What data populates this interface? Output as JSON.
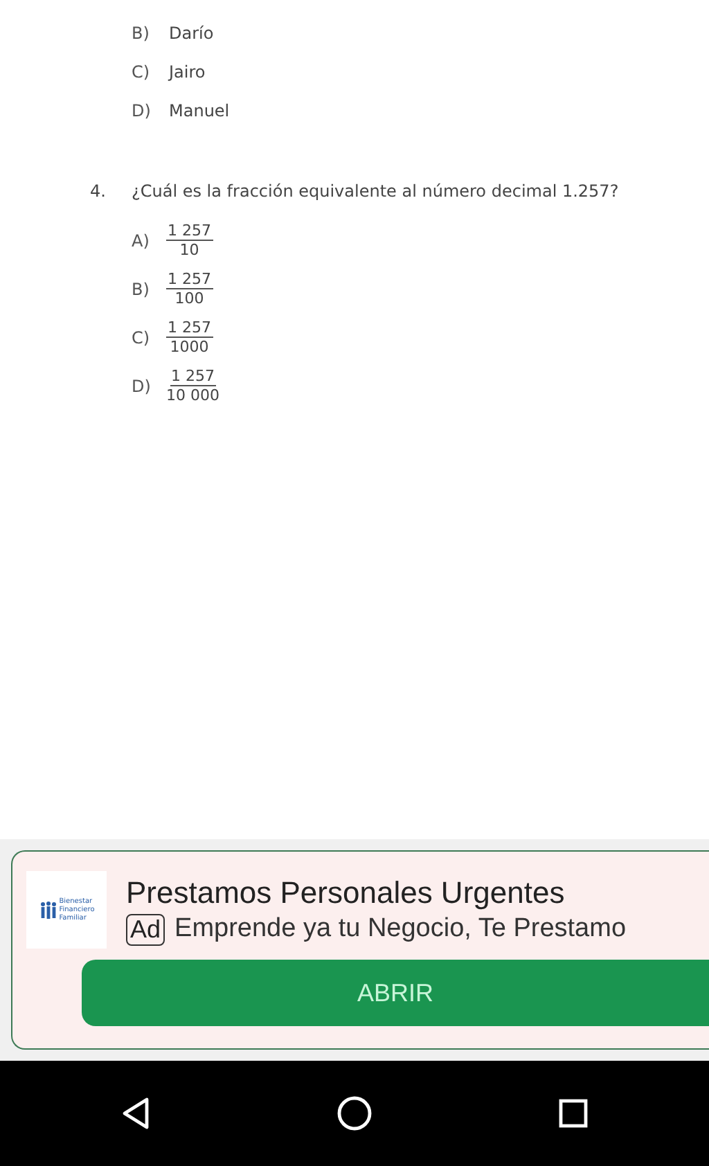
{
  "question_3_options": [
    {
      "letter": "B)",
      "text": "Darío"
    },
    {
      "letter": "C)",
      "text": "Jairo"
    },
    {
      "letter": "D)",
      "text": "Manuel"
    }
  ],
  "question_4": {
    "number": "4.",
    "text": "¿Cuál es la fracción equivalente al número decimal 1.257?",
    "options": [
      {
        "letter": "A)",
        "numerator": "1 257",
        "denominator": "10"
      },
      {
        "letter": "B)",
        "numerator": "1 257",
        "denominator": "100"
      },
      {
        "letter": "C)",
        "numerator": "1 257",
        "denominator": "1000"
      },
      {
        "letter": "D)",
        "numerator": "1 257",
        "denominator": "10 000"
      }
    ]
  },
  "ad": {
    "logo_lines": [
      "Bienestar",
      "Financiero",
      "Familiar"
    ],
    "title": "Prestamos Personales Urgentes",
    "badge": "Ad",
    "description": "Emprende ya tu Negocio, Te Prestamo",
    "button": "ABRIR"
  }
}
